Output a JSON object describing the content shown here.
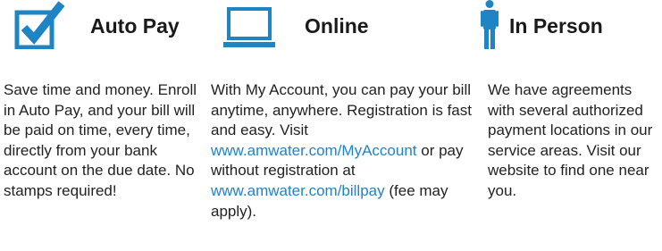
{
  "colors": {
    "accent": "#1f84c4",
    "text": "#222222"
  },
  "autopay": {
    "icon": "checkbox-check-icon",
    "title": "Auto Pay",
    "body": "Save time and money. Enroll in Auto Pay, and your bill will be paid on time, every time, directly from your bank account on the due date. No stamps required!"
  },
  "online": {
    "icon": "laptop-icon",
    "title": "Online",
    "body_1": "With My Account, you can pay your bill anytime, anywhere. Registration is fast and easy. Visit",
    "link_1": "www.amwater.com/MyAccount",
    "body_2": "or pay without registration at",
    "link_2": "www.amwater.com/billpay",
    "body_3": "(fee may apply)."
  },
  "inperson": {
    "icon": "person-icon",
    "title": "In Person",
    "body": "We have agreements with several authorized payment locations in our service areas. Visit our website to find one near you."
  }
}
